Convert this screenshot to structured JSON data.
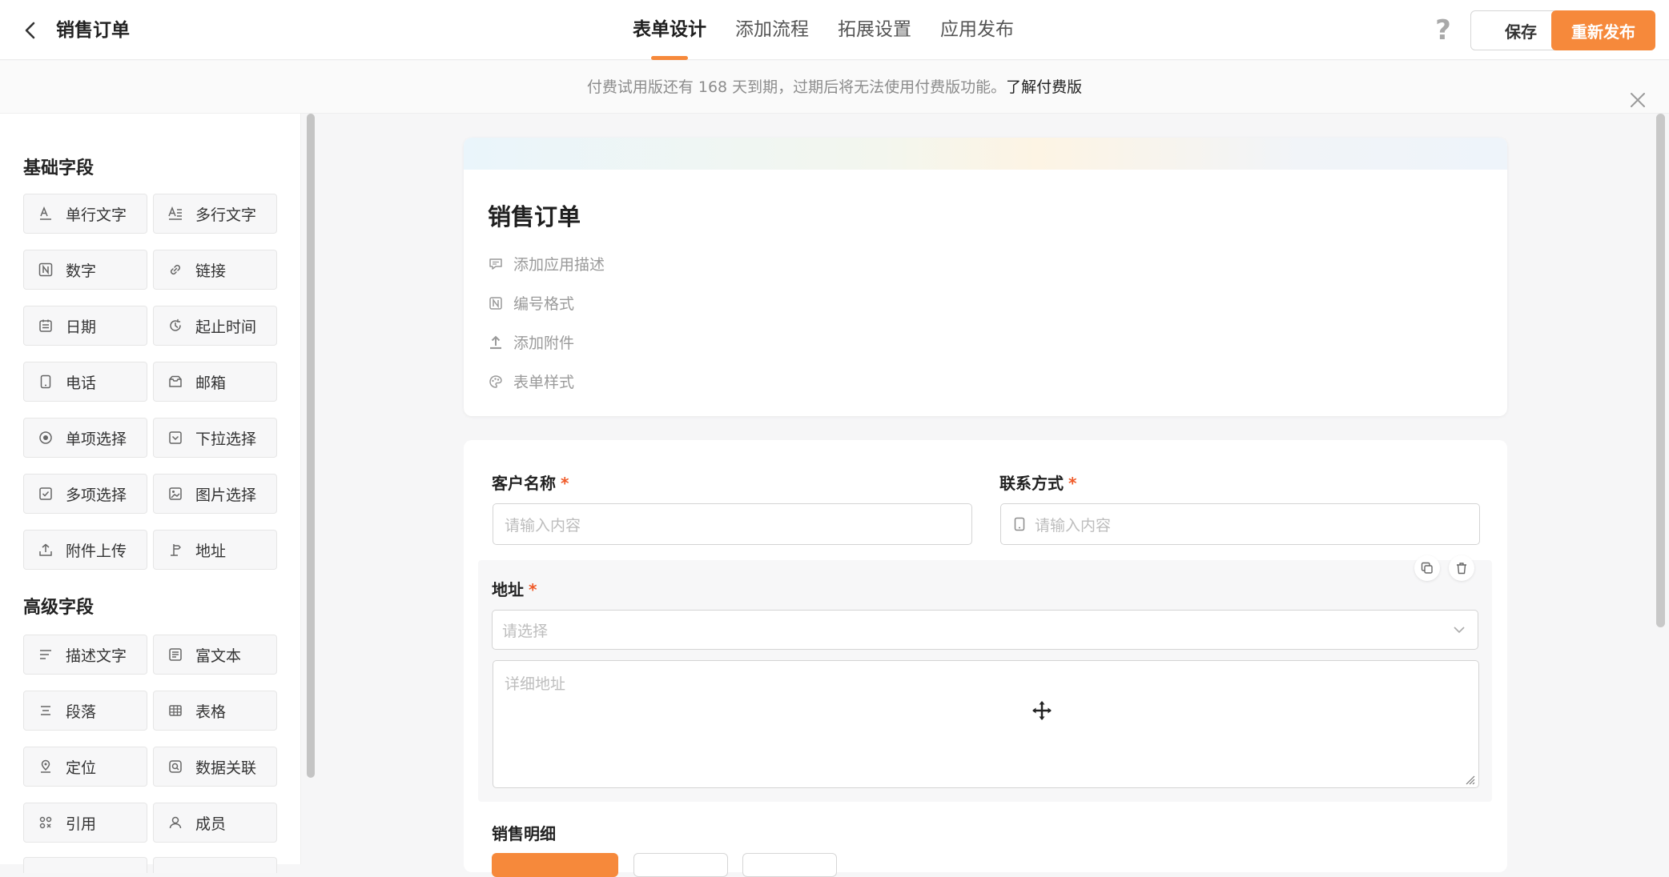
{
  "header": {
    "title": "销售订单",
    "tabs": [
      {
        "label": "表单设计",
        "active": true
      },
      {
        "label": "添加流程"
      },
      {
        "label": "拓展设置"
      },
      {
        "label": "应用发布"
      }
    ],
    "help": "?",
    "save_label": "保存",
    "publish_label": "重新发布"
  },
  "notice": {
    "text": "付费试用版还有 168 天到期，过期后将无法使用付费版功能。",
    "link": "了解付费版"
  },
  "sidebar": {
    "basic_title": "基础字段",
    "basic_fields": [
      {
        "label": "单行文字",
        "icon": "single-line-text-icon"
      },
      {
        "label": "多行文字",
        "icon": "multi-line-text-icon"
      },
      {
        "label": "数字",
        "icon": "number-icon"
      },
      {
        "label": "链接",
        "icon": "link-icon"
      },
      {
        "label": "日期",
        "icon": "calendar-icon"
      },
      {
        "label": "起止时间",
        "icon": "time-range-icon"
      },
      {
        "label": "电话",
        "icon": "phone-icon"
      },
      {
        "label": "邮箱",
        "icon": "mail-icon"
      },
      {
        "label": "单项选择",
        "icon": "radio-icon"
      },
      {
        "label": "下拉选择",
        "icon": "dropdown-icon"
      },
      {
        "label": "多项选择",
        "icon": "checkbox-icon"
      },
      {
        "label": "图片选择",
        "icon": "image-icon"
      },
      {
        "label": "附件上传",
        "icon": "upload-icon"
      },
      {
        "label": "地址",
        "icon": "address-icon"
      }
    ],
    "advanced_title": "高级字段",
    "advanced_fields": [
      {
        "label": "描述文字",
        "icon": "description-icon"
      },
      {
        "label": "富文本",
        "icon": "rich-text-icon"
      },
      {
        "label": "段落",
        "icon": "paragraph-icon"
      },
      {
        "label": "表格",
        "icon": "table-icon"
      },
      {
        "label": "定位",
        "icon": "location-icon"
      },
      {
        "label": "数据关联",
        "icon": "data-link-icon"
      },
      {
        "label": "引用",
        "icon": "reference-icon"
      },
      {
        "label": "成员",
        "icon": "member-icon"
      }
    ]
  },
  "form": {
    "title": "销售订单",
    "meta": [
      {
        "label": "添加应用描述",
        "icon": "comment-icon"
      },
      {
        "label": "编号格式",
        "icon": "number-icon"
      },
      {
        "label": "添加附件",
        "icon": "upload-icon"
      },
      {
        "label": "表单样式",
        "icon": "palette-icon"
      }
    ],
    "customer_label": "客户名称",
    "customer_placeholder": "请输入内容",
    "contact_label": "联系方式",
    "contact_placeholder": "请输入内容",
    "address_label": "地址",
    "address_select_placeholder": "请选择",
    "address_detail_placeholder": "详细地址",
    "required_mark": "*",
    "detail_label": "销售明细"
  },
  "colors": {
    "accent": "#f6893b",
    "required": "#f05a28"
  }
}
